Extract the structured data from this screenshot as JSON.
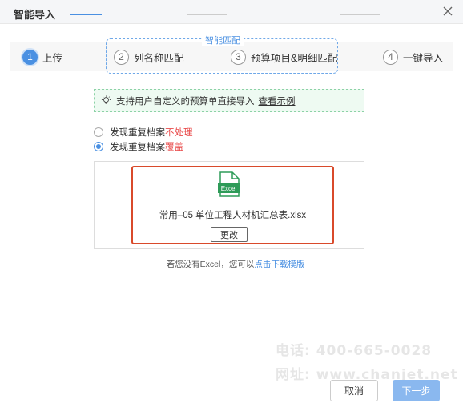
{
  "dialog": {
    "title": "智能导入"
  },
  "steps": [
    {
      "number": "1",
      "label": "上传"
    },
    {
      "number": "2",
      "label": "列名称匹配"
    },
    {
      "number": "3",
      "label": "预算项目&明细匹配"
    },
    {
      "number": "4",
      "label": "一键导入"
    }
  ],
  "steps_group_label": "智能匹配",
  "tip": {
    "text": "支持用户自定义的预算单直接导入",
    "link": "查看示例"
  },
  "options": [
    {
      "prefix": "发现重复档案",
      "suffix": "不处理",
      "checked": false
    },
    {
      "prefix": "发现重复档案",
      "suffix": "覆盖",
      "checked": true
    }
  ],
  "upload": {
    "icon_label": "Excel",
    "filename": "常用–05 单位工程人材机汇总表.xlsx",
    "change_label": "更改"
  },
  "note": {
    "text": "若您没有Excel，您可以",
    "link": "点击下载模版"
  },
  "watermark": {
    "line1": "电话: 400-665-0028",
    "line2": "网址: www.chanjet.net"
  },
  "footer": {
    "cancel": "取消",
    "next": "下一步"
  },
  "colors": {
    "accent": "#4a90e2",
    "highlight": "#d94a2b",
    "excel": "#2e9b58",
    "danger": "#e94b4b"
  }
}
